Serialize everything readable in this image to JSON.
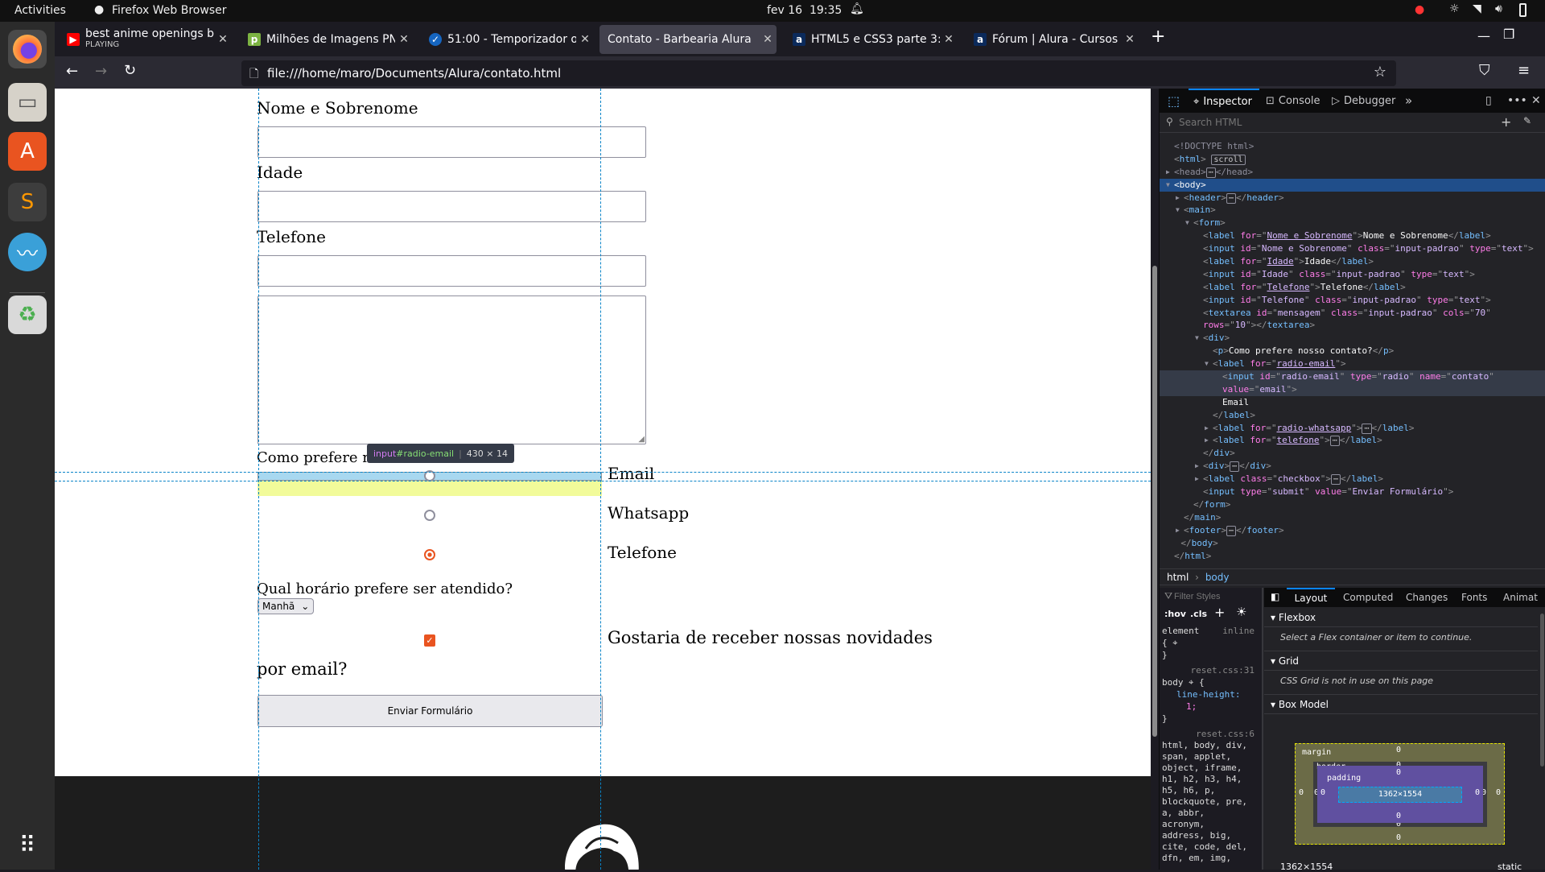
{
  "topbar": {
    "activities": "Activities",
    "app": "Firefox Web Browser",
    "clock": "fev 16  19:35"
  },
  "tabs": [
    {
      "title": "best anime openings but i",
      "sub": "PLAYING",
      "icon": "youtube-icon",
      "color": "#ff0000"
    },
    {
      "title": "Milhões de Imagens PNG,",
      "icon": "pngwing-icon",
      "color": "#7cb342"
    },
    {
      "title": "51:00 - Temporizador onli",
      "icon": "timer-check-icon",
      "color": "#1565c0"
    },
    {
      "title": "Contato - Barbearia Alura",
      "active": true
    },
    {
      "title": "HTML5 e CSS3 parte 3: Tra",
      "icon": "alura-icon",
      "color": "#0b2a5b"
    },
    {
      "title": "Fórum | Alura - Cursos onl",
      "icon": "alura-icon",
      "color": "#0b2a5b"
    }
  ],
  "url": "file:///home/maro/Documents/Alura/contato.html",
  "form": {
    "name_label": "Nome e Sobrenome",
    "age_label": "Idade",
    "phone_label": "Telefone",
    "contact_question": "Como prefere nosso contato?",
    "radio_email": "Email",
    "radio_whatsapp": "Whatsapp",
    "radio_phone": "Telefone",
    "selected_radio": "Telefone",
    "schedule_question": "Qual horário prefere ser atendido?",
    "schedule_value": "Manhã",
    "newsletter_label": "Gostaria de receber nossas novidades",
    "newsletter_label_cont": "por email?",
    "newsletter_checked": true,
    "submit": "Enviar Formulário"
  },
  "tooltip": {
    "selector_tag": "input",
    "selector_id": "#radio-email",
    "size": "430 × 14"
  },
  "devtools": {
    "tabs": [
      "Inspector",
      "Console",
      "Debugger"
    ],
    "search_placeholder": "Search HTML",
    "breadcrumb": [
      "html",
      "body"
    ],
    "filter_placeholder": "Filter Styles",
    "hov": ":hov",
    "cls": ".cls",
    "layout_tabs": [
      "Layout",
      "Computed",
      "Changes",
      "Fonts",
      "Animat"
    ],
    "flexbox": "Flexbox",
    "flex_msg": "Select a Flex container or item to continue.",
    "grid": "Grid",
    "grid_msg": "CSS Grid is not in use on this page",
    "boxmodel": "Box Model",
    "margin": "margin",
    "border": "border",
    "padding": "padding",
    "content_size": "1362×1554",
    "zero": "0",
    "footer_size": "1362×1554",
    "position": "static",
    "rules": {
      "element": "element",
      "inline": "inline",
      "src1": "reset.css:31",
      "sel1": "body",
      "prop1": "line-height:",
      "val1": "1;",
      "src2": "reset.css:6",
      "sel2": "html, body, div,\nspan, applet,\nobject, iframe,\nh1, h2, h3, h4,\nh5, h6, p,\nblockquote, pre,\na, abbr,\nacronym,\naddress, big,\ncite, code, del,\ndfn, em, img,"
    },
    "lines": [
      {
        "i": 0,
        "s": [
          [
            "dim",
            "<!DOCTYPE html>"
          ]
        ]
      },
      {
        "i": 0,
        "s": [
          [
            "pu",
            "<"
          ],
          [
            "tg",
            "html"
          ],
          [
            "pu",
            "> "
          ],
          [
            "badge",
            "scroll"
          ]
        ]
      },
      {
        "i": 0,
        "a": "▶",
        "s": [
          [
            "dim",
            "<head>"
          ],
          [
            "badge",
            "⋯"
          ],
          [
            "dim",
            "</head>"
          ]
        ]
      },
      {
        "i": 0,
        "a": "▼",
        "sel": true,
        "s": [
          [
            "tx",
            "<body>"
          ]
        ]
      },
      {
        "i": 1,
        "a": "▶",
        "s": [
          [
            "pu",
            "<"
          ],
          [
            "tg",
            "header"
          ],
          [
            "pu",
            ">"
          ],
          [
            "badge",
            "⋯"
          ],
          [
            "pu",
            "</"
          ],
          [
            "tg",
            "header"
          ],
          [
            "pu",
            ">"
          ]
        ]
      },
      {
        "i": 1,
        "a": "▼",
        "s": [
          [
            "pu",
            "<"
          ],
          [
            "tg",
            "main"
          ],
          [
            "pu",
            ">"
          ]
        ]
      },
      {
        "i": 2,
        "a": "▼",
        "s": [
          [
            "pu",
            "<"
          ],
          [
            "tg",
            "form"
          ],
          [
            "pu",
            ">"
          ]
        ]
      },
      {
        "i": 3,
        "s": [
          [
            "pu",
            "<"
          ],
          [
            "tg",
            "label "
          ],
          [
            "an",
            "for"
          ],
          [
            "pu",
            "=\""
          ],
          [
            "lnk",
            "Nome e Sobrenome"
          ],
          [
            "pu",
            "\">"
          ],
          [
            "tx",
            "Nome e Sobrenome"
          ],
          [
            "pu",
            "</"
          ],
          [
            "tg",
            "label"
          ],
          [
            "pu",
            ">"
          ]
        ]
      },
      {
        "i": 3,
        "s": [
          [
            "pu",
            "<"
          ],
          [
            "tg",
            "input "
          ],
          [
            "an",
            "id"
          ],
          [
            "pu",
            "=\""
          ],
          [
            "av",
            "Nome e Sobrenome"
          ],
          [
            "pu",
            "\" "
          ],
          [
            "an",
            "class"
          ],
          [
            "pu",
            "=\""
          ],
          [
            "av",
            "input-padrao"
          ],
          [
            "pu",
            "\" "
          ],
          [
            "an",
            "type"
          ],
          [
            "pu",
            "=\""
          ],
          [
            "av",
            "text"
          ],
          [
            "pu",
            "\">"
          ]
        ]
      },
      {
        "i": 3,
        "s": [
          [
            "pu",
            "<"
          ],
          [
            "tg",
            "label "
          ],
          [
            "an",
            "for"
          ],
          [
            "pu",
            "=\""
          ],
          [
            "lnk",
            "Idade"
          ],
          [
            "pu",
            "\">"
          ],
          [
            "tx",
            "Idade"
          ],
          [
            "pu",
            "</"
          ],
          [
            "tg",
            "label"
          ],
          [
            "pu",
            ">"
          ]
        ]
      },
      {
        "i": 3,
        "s": [
          [
            "pu",
            "<"
          ],
          [
            "tg",
            "input "
          ],
          [
            "an",
            "id"
          ],
          [
            "pu",
            "=\""
          ],
          [
            "av",
            "Idade"
          ],
          [
            "pu",
            "\" "
          ],
          [
            "an",
            "class"
          ],
          [
            "pu",
            "=\""
          ],
          [
            "av",
            "input-padrao"
          ],
          [
            "pu",
            "\" "
          ],
          [
            "an",
            "type"
          ],
          [
            "pu",
            "=\""
          ],
          [
            "av",
            "text"
          ],
          [
            "pu",
            "\">"
          ]
        ]
      },
      {
        "i": 3,
        "s": [
          [
            "pu",
            "<"
          ],
          [
            "tg",
            "label "
          ],
          [
            "an",
            "for"
          ],
          [
            "pu",
            "=\""
          ],
          [
            "lnk",
            "Telefone"
          ],
          [
            "pu",
            "\">"
          ],
          [
            "tx",
            "Telefone"
          ],
          [
            "pu",
            "</"
          ],
          [
            "tg",
            "label"
          ],
          [
            "pu",
            ">"
          ]
        ]
      },
      {
        "i": 3,
        "s": [
          [
            "pu",
            "<"
          ],
          [
            "tg",
            "input "
          ],
          [
            "an",
            "id"
          ],
          [
            "pu",
            "=\""
          ],
          [
            "av",
            "Telefone"
          ],
          [
            "pu",
            "\" "
          ],
          [
            "an",
            "class"
          ],
          [
            "pu",
            "=\""
          ],
          [
            "av",
            "input-padrao"
          ],
          [
            "pu",
            "\" "
          ],
          [
            "an",
            "type"
          ],
          [
            "pu",
            "=\""
          ],
          [
            "av",
            "text"
          ],
          [
            "pu",
            "\">"
          ]
        ]
      },
      {
        "i": 3,
        "s": [
          [
            "pu",
            "<"
          ],
          [
            "tg",
            "textarea "
          ],
          [
            "an",
            "id"
          ],
          [
            "pu",
            "=\""
          ],
          [
            "av",
            "mensagem"
          ],
          [
            "pu",
            "\" "
          ],
          [
            "an",
            "class"
          ],
          [
            "pu",
            "=\""
          ],
          [
            "av",
            "input-padrao"
          ],
          [
            "pu",
            "\" "
          ],
          [
            "an",
            "cols"
          ],
          [
            "pu",
            "=\""
          ],
          [
            "av",
            "70"
          ],
          [
            "pu",
            "\""
          ]
        ]
      },
      {
        "i": 3,
        "s": [
          [
            "an",
            "rows"
          ],
          [
            "pu",
            "=\""
          ],
          [
            "av",
            "10"
          ],
          [
            "pu",
            "\"></"
          ],
          [
            "tg",
            "textarea"
          ],
          [
            "pu",
            ">"
          ]
        ]
      },
      {
        "i": 3,
        "a": "▼",
        "s": [
          [
            "pu",
            "<"
          ],
          [
            "tg",
            "div"
          ],
          [
            "pu",
            ">"
          ]
        ]
      },
      {
        "i": 4,
        "s": [
          [
            "pu",
            "<"
          ],
          [
            "tg",
            "p"
          ],
          [
            "pu",
            ">"
          ],
          [
            "tx",
            "Como prefere nosso contato?"
          ],
          [
            "pu",
            "</"
          ],
          [
            "tg",
            "p"
          ],
          [
            "pu",
            ">"
          ]
        ]
      },
      {
        "i": 4,
        "a": "▼",
        "s": [
          [
            "pu",
            "<"
          ],
          [
            "tg",
            "label "
          ],
          [
            "an",
            "for"
          ],
          [
            "pu",
            "=\""
          ],
          [
            "lnk",
            "radio-email"
          ],
          [
            "pu",
            "\">"
          ]
        ]
      },
      {
        "i": 5,
        "hov": true,
        "s": [
          [
            "pu",
            "<"
          ],
          [
            "tg",
            "input "
          ],
          [
            "an",
            "id"
          ],
          [
            "pu",
            "=\""
          ],
          [
            "av",
            "radio-email"
          ],
          [
            "pu",
            "\" "
          ],
          [
            "an",
            "type"
          ],
          [
            "pu",
            "=\""
          ],
          [
            "av",
            "radio"
          ],
          [
            "pu",
            "\" "
          ],
          [
            "an",
            "name"
          ],
          [
            "pu",
            "=\""
          ],
          [
            "av",
            "contato"
          ],
          [
            "pu",
            "\""
          ]
        ]
      },
      {
        "i": 5,
        "hov": true,
        "s": [
          [
            "an",
            "value"
          ],
          [
            "pu",
            "=\""
          ],
          [
            "av",
            "email"
          ],
          [
            "pu",
            "\">"
          ]
        ]
      },
      {
        "i": 5,
        "s": [
          [
            "tx",
            "Email"
          ]
        ]
      },
      {
        "i": 4,
        "s": [
          [
            "pu",
            "</"
          ],
          [
            "tg",
            "label"
          ],
          [
            "pu",
            ">"
          ]
        ]
      },
      {
        "i": 4,
        "a": "▶",
        "s": [
          [
            "pu",
            "<"
          ],
          [
            "tg",
            "label "
          ],
          [
            "an",
            "for"
          ],
          [
            "pu",
            "=\""
          ],
          [
            "lnk",
            "radio-whatsapp"
          ],
          [
            "pu",
            "\">"
          ],
          [
            "badge",
            "⋯"
          ],
          [
            "pu",
            "</"
          ],
          [
            "tg",
            "label"
          ],
          [
            "pu",
            ">"
          ]
        ]
      },
      {
        "i": 4,
        "a": "▶",
        "s": [
          [
            "pu",
            "<"
          ],
          [
            "tg",
            "label "
          ],
          [
            "an",
            "for"
          ],
          [
            "pu",
            "=\""
          ],
          [
            "lnk",
            "telefone"
          ],
          [
            "pu",
            "\">"
          ],
          [
            "badge",
            "⋯"
          ],
          [
            "pu",
            "</"
          ],
          [
            "tg",
            "label"
          ],
          [
            "pu",
            ">"
          ]
        ]
      },
      {
        "i": 3,
        "s": [
          [
            "pu",
            "</"
          ],
          [
            "tg",
            "div"
          ],
          [
            "pu",
            ">"
          ]
        ]
      },
      {
        "i": 3,
        "a": "▶",
        "s": [
          [
            "pu",
            "<"
          ],
          [
            "tg",
            "div"
          ],
          [
            "pu",
            ">"
          ],
          [
            "badge",
            "⋯"
          ],
          [
            "pu",
            "</"
          ],
          [
            "tg",
            "div"
          ],
          [
            "pu",
            ">"
          ]
        ]
      },
      {
        "i": 3,
        "a": "▶",
        "s": [
          [
            "pu",
            "<"
          ],
          [
            "tg",
            "label "
          ],
          [
            "an",
            "class"
          ],
          [
            "pu",
            "=\""
          ],
          [
            "av",
            "checkbox"
          ],
          [
            "pu",
            "\">"
          ],
          [
            "badge",
            "⋯"
          ],
          [
            "pu",
            "</"
          ],
          [
            "tg",
            "label"
          ],
          [
            "pu",
            ">"
          ]
        ]
      },
      {
        "i": 3,
        "s": [
          [
            "pu",
            "<"
          ],
          [
            "tg",
            "input "
          ],
          [
            "an",
            "type"
          ],
          [
            "pu",
            "=\""
          ],
          [
            "av",
            "submit"
          ],
          [
            "pu",
            "\" "
          ],
          [
            "an",
            "value"
          ],
          [
            "pu",
            "=\""
          ],
          [
            "av",
            "Enviar Formulário"
          ],
          [
            "pu",
            "\">"
          ]
        ]
      },
      {
        "i": 2,
        "s": [
          [
            "pu",
            "</"
          ],
          [
            "tg",
            "form"
          ],
          [
            "pu",
            ">"
          ]
        ]
      },
      {
        "i": 1,
        "s": [
          [
            "pu",
            "</"
          ],
          [
            "tg",
            "main"
          ],
          [
            "pu",
            ">"
          ]
        ]
      },
      {
        "i": 1,
        "a": "▶",
        "s": [
          [
            "pu",
            "<"
          ],
          [
            "tg",
            "footer"
          ],
          [
            "pu",
            ">"
          ],
          [
            "badge",
            "⋯"
          ],
          [
            "pu",
            "</"
          ],
          [
            "tg",
            "footer"
          ],
          [
            "pu",
            ">"
          ]
        ]
      },
      {
        "i": 0.7,
        "s": [
          [
            "pu",
            "</"
          ],
          [
            "tg",
            "body"
          ],
          [
            "pu",
            ">"
          ]
        ]
      },
      {
        "i": 0,
        "s": [
          [
            "pu",
            "</"
          ],
          [
            "tg",
            "html"
          ],
          [
            "pu",
            ">"
          ]
        ]
      }
    ]
  },
  "colors": {
    "accent": "#e95420",
    "highlight": "#0a84ff",
    "selected_row": "#204e8a"
  }
}
